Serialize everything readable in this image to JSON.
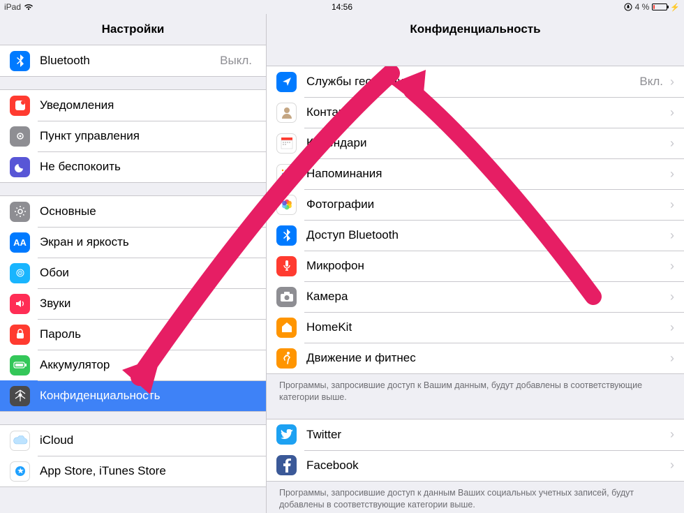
{
  "status": {
    "device": "iPad",
    "time": "14:56",
    "battery_pct": "4 %",
    "orientation_icon": "orientation-lock"
  },
  "sidebar": {
    "title": "Настройки",
    "groups": [
      {
        "items": [
          {
            "icon": "bluetooth-icon",
            "label": "Bluetooth",
            "value": "Выкл."
          }
        ]
      },
      {
        "items": [
          {
            "icon": "notifications-icon",
            "label": "Уведомления"
          },
          {
            "icon": "control-center-icon",
            "label": "Пункт управления"
          },
          {
            "icon": "do-not-disturb-icon",
            "label": "Не беспокоить"
          }
        ]
      },
      {
        "items": [
          {
            "icon": "general-icon",
            "label": "Основные"
          },
          {
            "icon": "display-icon",
            "label": "Экран и яркость"
          },
          {
            "icon": "wallpaper-icon",
            "label": "Обои"
          },
          {
            "icon": "sounds-icon",
            "label": "Звуки"
          },
          {
            "icon": "passcode-icon",
            "label": "Пароль"
          },
          {
            "icon": "battery-icon",
            "label": "Аккумулятор"
          },
          {
            "icon": "privacy-icon",
            "label": "Конфиденциальность",
            "selected": true
          }
        ]
      },
      {
        "items": [
          {
            "icon": "icloud-icon",
            "label": "iCloud"
          },
          {
            "icon": "appstore-icon",
            "label": "App Store, iTunes Store"
          }
        ]
      }
    ]
  },
  "detail": {
    "title": "Конфиденциальность",
    "groups": [
      {
        "items": [
          {
            "icon": "location-icon",
            "label": "Службы геолокации",
            "value": "Вкл."
          },
          {
            "icon": "contacts-icon",
            "label": "Контакты"
          },
          {
            "icon": "calendars-icon",
            "label": "Календари"
          },
          {
            "icon": "reminders-icon",
            "label": "Напоминания"
          },
          {
            "icon": "photos-icon",
            "label": "Фотографии"
          },
          {
            "icon": "bluetooth-sharing-icon",
            "label": "Доступ Bluetooth"
          },
          {
            "icon": "microphone-icon",
            "label": "Микрофон"
          },
          {
            "icon": "camera-icon",
            "label": "Камера"
          },
          {
            "icon": "homekit-icon",
            "label": "HomeKit"
          },
          {
            "icon": "motion-icon",
            "label": "Движение и фитнес"
          }
        ],
        "footer": "Программы, запросившие доступ к Вашим данным, будут добавлены в соответствующие категории выше."
      },
      {
        "items": [
          {
            "icon": "twitter-icon",
            "label": "Twitter"
          },
          {
            "icon": "facebook-icon",
            "label": "Facebook"
          }
        ],
        "footer": "Программы, запросившие доступ к данным Ваших социальных учетных записей, будут добавлены в соответствующие категории выше."
      }
    ]
  },
  "annotations": {
    "arrow_color": "#e61e64"
  }
}
